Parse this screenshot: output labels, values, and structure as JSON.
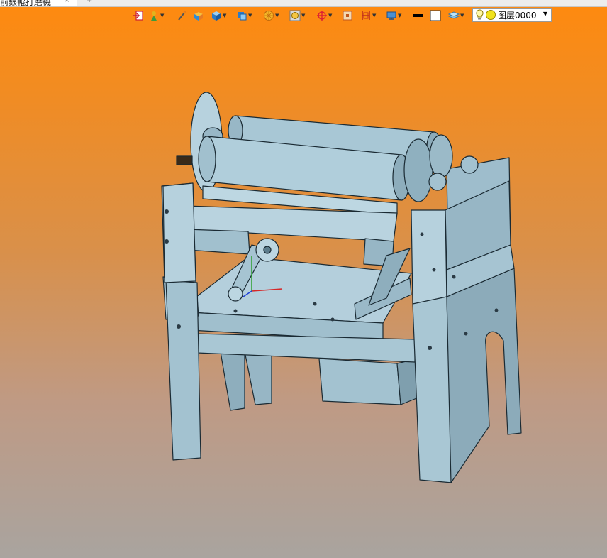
{
  "tab": {
    "title": "前銀輥打磨機",
    "close": "×",
    "add": "+"
  },
  "toolbar": {
    "icons": [
      "exit-sketch-icon",
      "paint-icon",
      "brush-icon",
      "box-orange-icon",
      "cube-icon",
      "view-cube-icon",
      "render-ball-icon",
      "zoom-icon",
      "origin-icon",
      "frame-icon",
      "section-icon",
      "network-icon",
      "line-color-icon",
      "fill-color-icon",
      "layer-stack-icon"
    ]
  },
  "layer": {
    "name": "图层0000"
  },
  "colors": {
    "part": "#9cbccb",
    "part_dark": "#7f9fae",
    "edge": "#1a2a33",
    "accent": "#ff8a0e"
  }
}
